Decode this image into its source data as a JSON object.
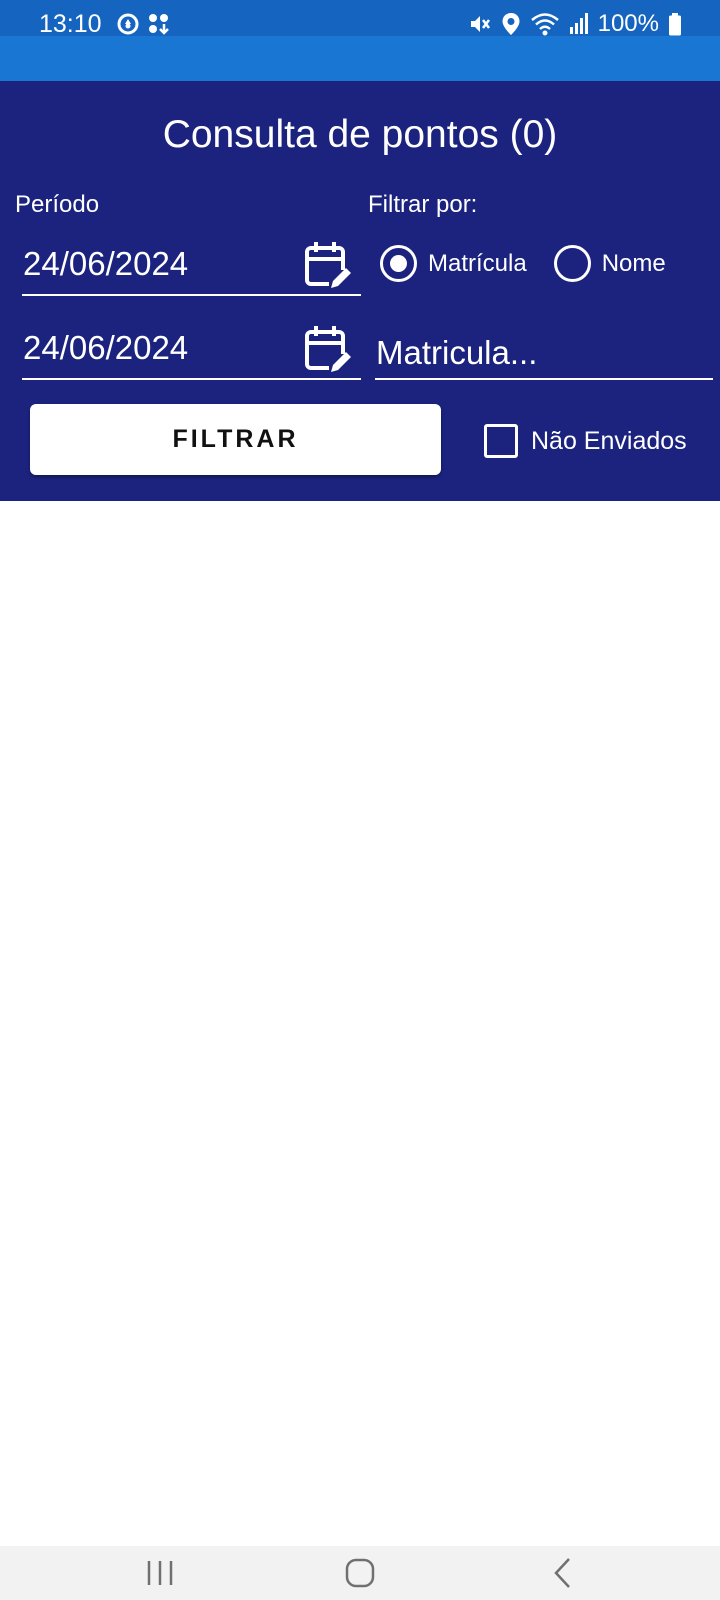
{
  "status_bar": {
    "time": "13:10",
    "battery": "100%",
    "left_icons": [
      "sync-icon",
      "app-notification-icon"
    ],
    "right_icons": [
      "mute-icon",
      "location-icon",
      "wifi-icon",
      "signal-icon",
      "battery-icon"
    ]
  },
  "header": {
    "title": "Consulta de pontos (0)"
  },
  "filters": {
    "period_label": "Período",
    "start_date": "24/06/2024",
    "end_date": "24/06/2024",
    "filter_by_label": "Filtrar por:",
    "filter_options": [
      {
        "label": "Matrícula",
        "selected": true
      },
      {
        "label": "Nome",
        "selected": false
      }
    ],
    "search_placeholder": "Matricula...",
    "search_value": "",
    "filter_button_label": "FILTRAR",
    "not_sent_label": "Não Enviados",
    "not_sent_checked": false
  },
  "results": {
    "items": []
  },
  "colors": {
    "status_bar": "#1565c0",
    "app_bar": "#1976d2",
    "panel": "#1b237e",
    "nav_bar": "#f2f2f2"
  }
}
